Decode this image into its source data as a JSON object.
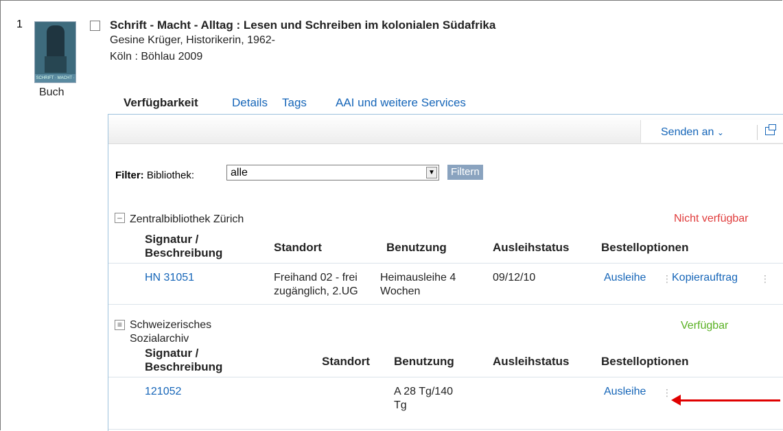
{
  "record": {
    "number": "1",
    "type": "Buch",
    "title": "Schrift - Macht - Alltag : Lesen und Schreiben im kolonialen Südafrika",
    "author": "Gesine Krüger, Historikerin, 1962-",
    "publication": "Köln : Böhlau 2009",
    "cover_text": "SCHRIFT · MACHT · ALLTAG"
  },
  "tabs": [
    "Verfügbarkeit",
    "Details",
    "Tags",
    "AAI und weitere Services"
  ],
  "toolbar": {
    "send_label": "Senden an"
  },
  "filter": {
    "label_bold": "Filter:",
    "label": "Bibliothek:",
    "selected": "alle",
    "button": "Filtern"
  },
  "libraries": [
    {
      "name": "Zentralbibliothek Zürich",
      "status": "Nicht verfügbar",
      "headers": {
        "signatur": "Signatur /",
        "beschreibung": "Beschreibung",
        "standort": "Standort",
        "benutzung": "Benutzung",
        "ausleihstatus": "Ausleihstatus",
        "bestelloptionen": "Bestelloptionen"
      },
      "rows": [
        {
          "signatur": "HN 31051",
          "standort_1": "Freihand 02 - frei",
          "standort_2": "zugänglich, 2.UG",
          "benutzung_1": "Heimausleihe 4",
          "benutzung_2": "Wochen",
          "ausleihstatus": "09/12/10",
          "option_1": "Ausleihe",
          "option_2": "Kopierauftrag"
        }
      ]
    },
    {
      "name_1": "Schweizerisches",
      "name_2": "Sozialarchiv",
      "status": "Verfügbar",
      "headers": {
        "signatur": "Signatur /",
        "beschreibung": "Beschreibung",
        "standort": "Standort",
        "benutzung": "Benutzung",
        "ausleihstatus": "Ausleihstatus",
        "bestelloptionen": "Bestelloptionen"
      },
      "rows": [
        {
          "signatur": "121052",
          "benutzung_1": "A 28 Tg/140",
          "benutzung_2": "Tg",
          "option_1": "Ausleihe"
        }
      ]
    }
  ],
  "colors": {
    "link": "#1565b8",
    "unavailable": "#e03b3b",
    "available": "#58b021",
    "annotation_arrow": "#e00000"
  }
}
